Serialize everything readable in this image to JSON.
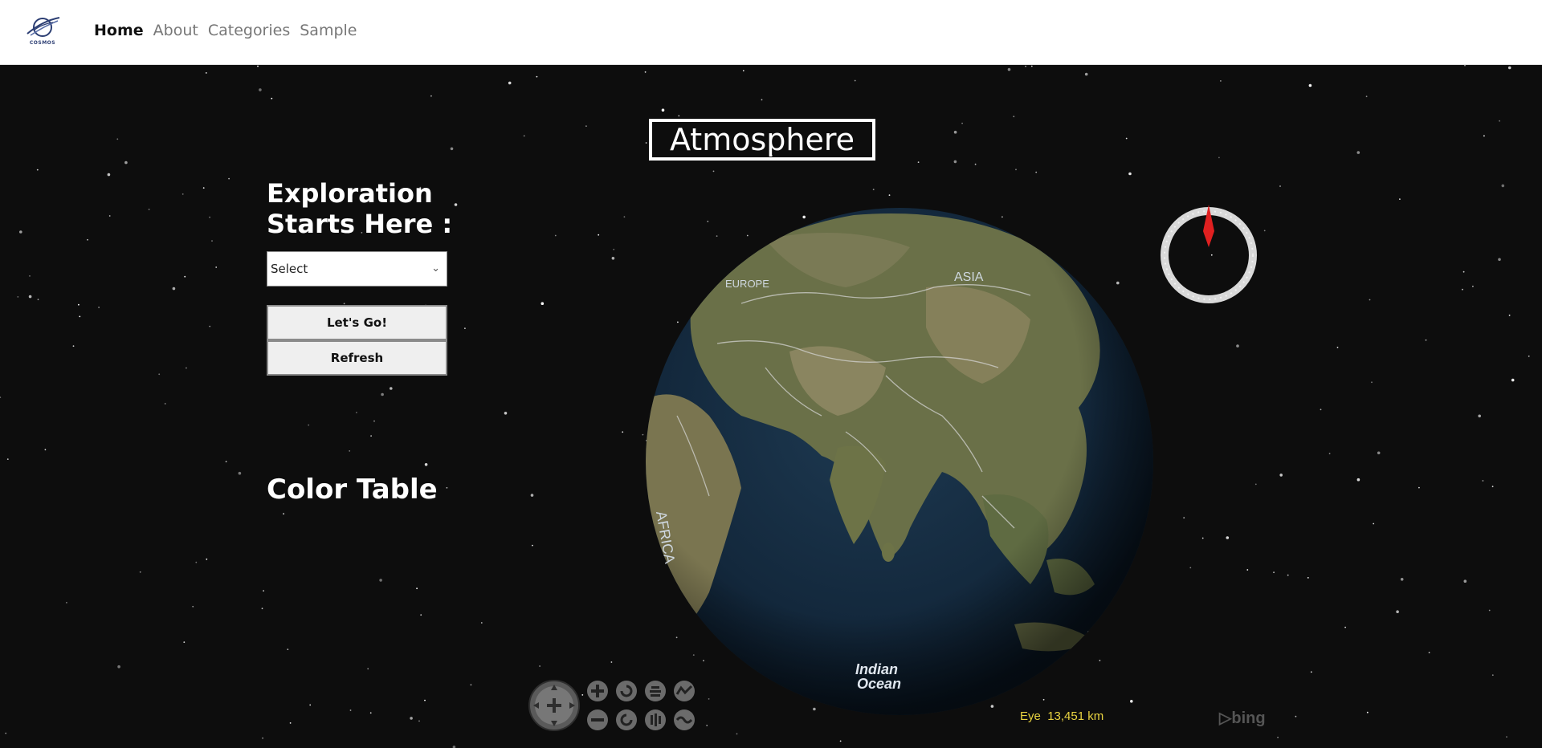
{
  "nav": {
    "logo_text": "COSMOS",
    "items": [
      {
        "label": "Home",
        "active": true
      },
      {
        "label": "About",
        "active": false
      },
      {
        "label": "Categories",
        "active": false
      },
      {
        "label": "Sample",
        "active": false
      }
    ]
  },
  "main": {
    "title": "Atmosphere",
    "explore_heading": "Exploration Starts Here :",
    "select": {
      "value": "Select"
    },
    "buttons": {
      "go": "Let's Go!",
      "refresh": "Refresh"
    },
    "color_table_heading": "Color Table"
  },
  "globe": {
    "labels": {
      "europe": "EUROPE",
      "asia": "ASIA",
      "africa": "AFRICA",
      "ocean_line1": "Indian",
      "ocean_line2": "Ocean"
    },
    "eye_label": "Eye",
    "eye_altitude": "13,451 km",
    "attribution": "bing"
  },
  "colors": {
    "background": "#0d0d0d",
    "eye_text": "#e8d340",
    "compass_needle": "#e02020"
  }
}
